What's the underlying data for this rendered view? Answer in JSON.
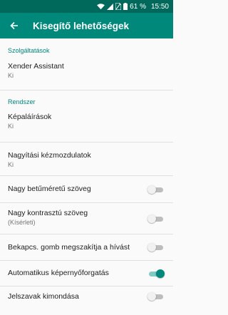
{
  "status_bar": {
    "battery": "61 %",
    "time": "15:50"
  },
  "app_bar": {
    "title": "Kisegítő lehetőségek"
  },
  "sections": {
    "services": {
      "header": "Szolgáltatások",
      "items": [
        {
          "label": "Xender Assistant",
          "summary": "Ki"
        }
      ]
    },
    "system": {
      "header": "Rendszer",
      "items": [
        {
          "label": "Képaláírások",
          "summary": "Ki"
        },
        {
          "label": "Nagyítási kézmozdulatok",
          "summary": "Ki"
        },
        {
          "label": "Nagy betűméretű szöveg",
          "switch": "off"
        },
        {
          "label": "Nagy kontrasztú szöveg",
          "summary": "(Kísérleti)",
          "switch": "off"
        },
        {
          "label": "Bekapcs. gomb megszakítja a hívást",
          "switch": "off"
        },
        {
          "label": "Automatikus képernyőforgatás",
          "switch": "on"
        },
        {
          "label": "Jelszavak kimondása",
          "switch": "off"
        }
      ]
    }
  },
  "colors": {
    "accent": "#00897b",
    "status_bar": "#00695c"
  }
}
